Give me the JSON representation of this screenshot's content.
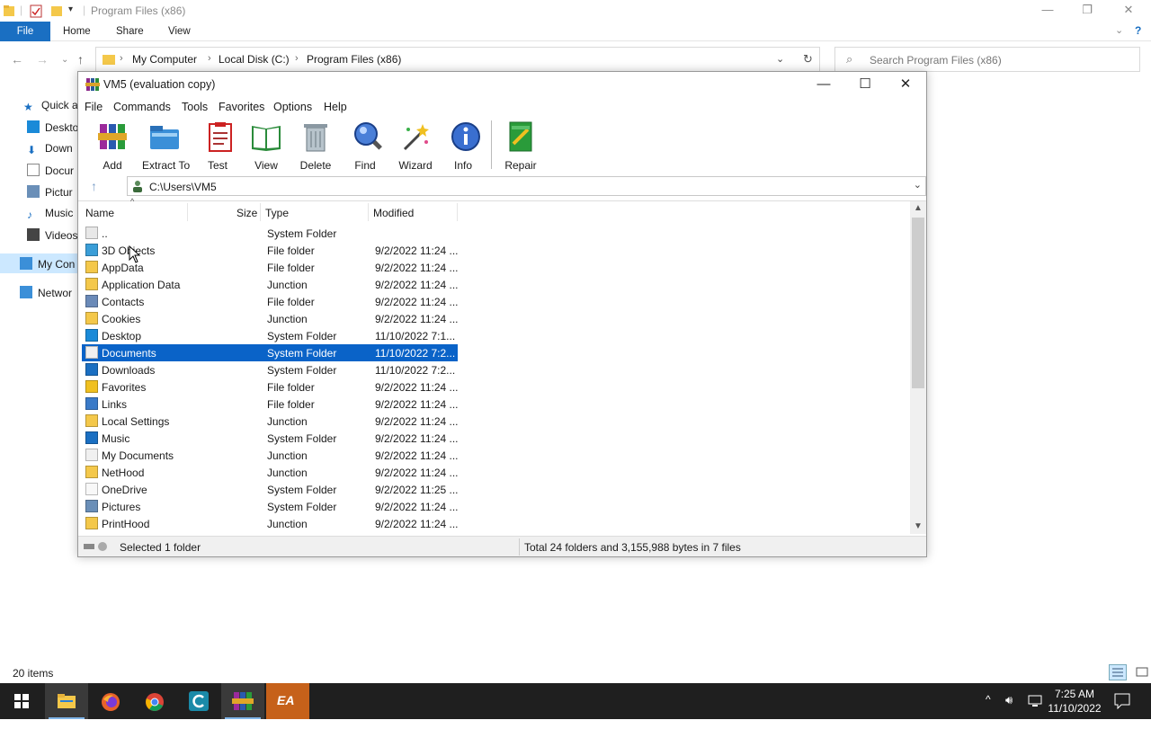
{
  "explorer": {
    "title": "Program Files (x86)",
    "ribbon_tabs": [
      "File",
      "Home",
      "Share",
      "View"
    ],
    "breadcrumb": [
      "My Computer",
      "Local Disk (C:)",
      "Program Files (x86)"
    ],
    "search_placeholder": "Search Program Files (x86)",
    "sidebar": [
      "Quick a",
      "Deskto",
      "Down",
      "Docur",
      "Pictur",
      "Music",
      "Videos",
      "My Con",
      "Networ"
    ],
    "status": "20 items"
  },
  "winrar": {
    "title": "VM5 (evaluation copy)",
    "menu": [
      "File",
      "Commands",
      "Tools",
      "Favorites",
      "Options",
      "Help"
    ],
    "toolbar": [
      "Add",
      "Extract To",
      "Test",
      "View",
      "Delete",
      "Find",
      "Wizard",
      "Info",
      "Repair"
    ],
    "path": "C:\\Users\\VM5",
    "columns": {
      "name": "Name",
      "size": "Size",
      "type": "Type",
      "modified": "Modified"
    },
    "files": [
      {
        "name": "..",
        "size": "",
        "type": "System Folder",
        "modified": "",
        "icon": "parent-folder-icon"
      },
      {
        "name": "3D Objects",
        "size": "",
        "type": "File folder",
        "modified": "9/2/2022 11:24 ...",
        "icon": "3d-objects-icon"
      },
      {
        "name": "AppData",
        "size": "",
        "type": "File folder",
        "modified": "9/2/2022 11:24 ...",
        "icon": "folder-icon"
      },
      {
        "name": "Application Data",
        "size": "",
        "type": "Junction",
        "modified": "9/2/2022 11:24 ...",
        "icon": "folder-icon"
      },
      {
        "name": "Contacts",
        "size": "",
        "type": "File folder",
        "modified": "9/2/2022 11:24 ...",
        "icon": "contacts-icon"
      },
      {
        "name": "Cookies",
        "size": "",
        "type": "Junction",
        "modified": "9/2/2022 11:24 ...",
        "icon": "folder-icon"
      },
      {
        "name": "Desktop",
        "size": "",
        "type": "System Folder",
        "modified": "11/10/2022 7:1...",
        "icon": "desktop-icon"
      },
      {
        "name": "Documents",
        "size": "",
        "type": "System Folder",
        "modified": "11/10/2022 7:2...",
        "icon": "documents-icon"
      },
      {
        "name": "Downloads",
        "size": "",
        "type": "System Folder",
        "modified": "11/10/2022 7:2...",
        "icon": "downloads-icon"
      },
      {
        "name": "Favorites",
        "size": "",
        "type": "File folder",
        "modified": "9/2/2022 11:24 ...",
        "icon": "favorites-icon"
      },
      {
        "name": "Links",
        "size": "",
        "type": "File folder",
        "modified": "9/2/2022 11:24 ...",
        "icon": "links-icon"
      },
      {
        "name": "Local Settings",
        "size": "",
        "type": "Junction",
        "modified": "9/2/2022 11:24 ...",
        "icon": "folder-icon"
      },
      {
        "name": "Music",
        "size": "",
        "type": "System Folder",
        "modified": "9/2/2022 11:24 ...",
        "icon": "music-icon"
      },
      {
        "name": "My Documents",
        "size": "",
        "type": "Junction",
        "modified": "9/2/2022 11:24 ...",
        "icon": "documents-icon"
      },
      {
        "name": "NetHood",
        "size": "",
        "type": "Junction",
        "modified": "9/2/2022 11:24 ...",
        "icon": "folder-icon"
      },
      {
        "name": "OneDrive",
        "size": "",
        "type": "System Folder",
        "modified": "9/2/2022 11:25 ...",
        "icon": "onedrive-icon"
      },
      {
        "name": "Pictures",
        "size": "",
        "type": "System Folder",
        "modified": "9/2/2022 11:24 ...",
        "icon": "pictures-icon"
      },
      {
        "name": "PrintHood",
        "size": "",
        "type": "Junction",
        "modified": "9/2/2022 11:24 ...",
        "icon": "folder-icon"
      }
    ],
    "selected_index": 7,
    "status_left": "Selected 1 folder",
    "status_right": "Total 24 folders and 3,155,988 bytes in 7 files"
  },
  "taskbar": {
    "time": "7:25 AM",
    "date": "11/10/2022"
  },
  "colors": {
    "accent": "#0a63c8",
    "file_tab": "#1a6fc2",
    "taskbar": "#1f1f1f"
  }
}
